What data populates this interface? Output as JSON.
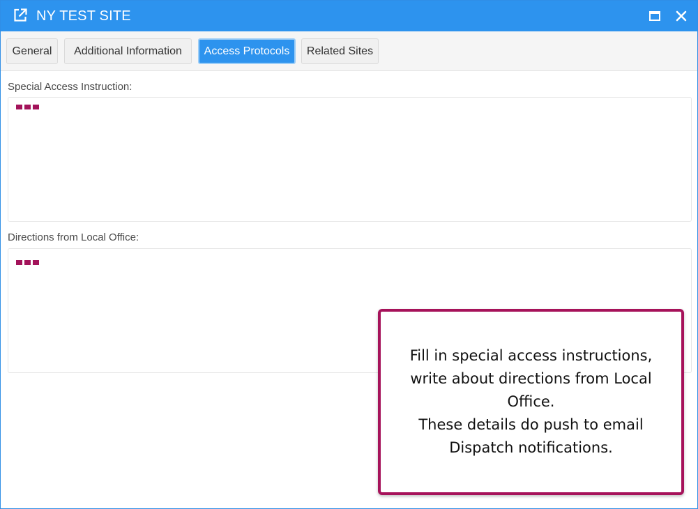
{
  "window": {
    "title": "NY TEST SITE",
    "icons": {
      "title": "external-link-icon",
      "maximize": "maximize-icon",
      "close": "close-icon"
    },
    "colors": {
      "titlebar": "#2d93ee",
      "active_tab": "#2d93ee",
      "accent": "#a6125a"
    }
  },
  "tabs": [
    {
      "label": "General",
      "active": false
    },
    {
      "label": "Additional Information",
      "active": false
    },
    {
      "label": "Access Protocols",
      "active": true
    },
    {
      "label": "Related Sites",
      "active": false
    }
  ],
  "fields": {
    "special_access": {
      "label": "Special Access Instruction:",
      "value": ""
    },
    "directions": {
      "label": "Directions from Local Office:",
      "value": ""
    }
  },
  "callout": {
    "text": "Fill in special access instructions,\nwrite about directions from Local\nOffice.\nThese details do push to email\nDispatch notifications."
  }
}
